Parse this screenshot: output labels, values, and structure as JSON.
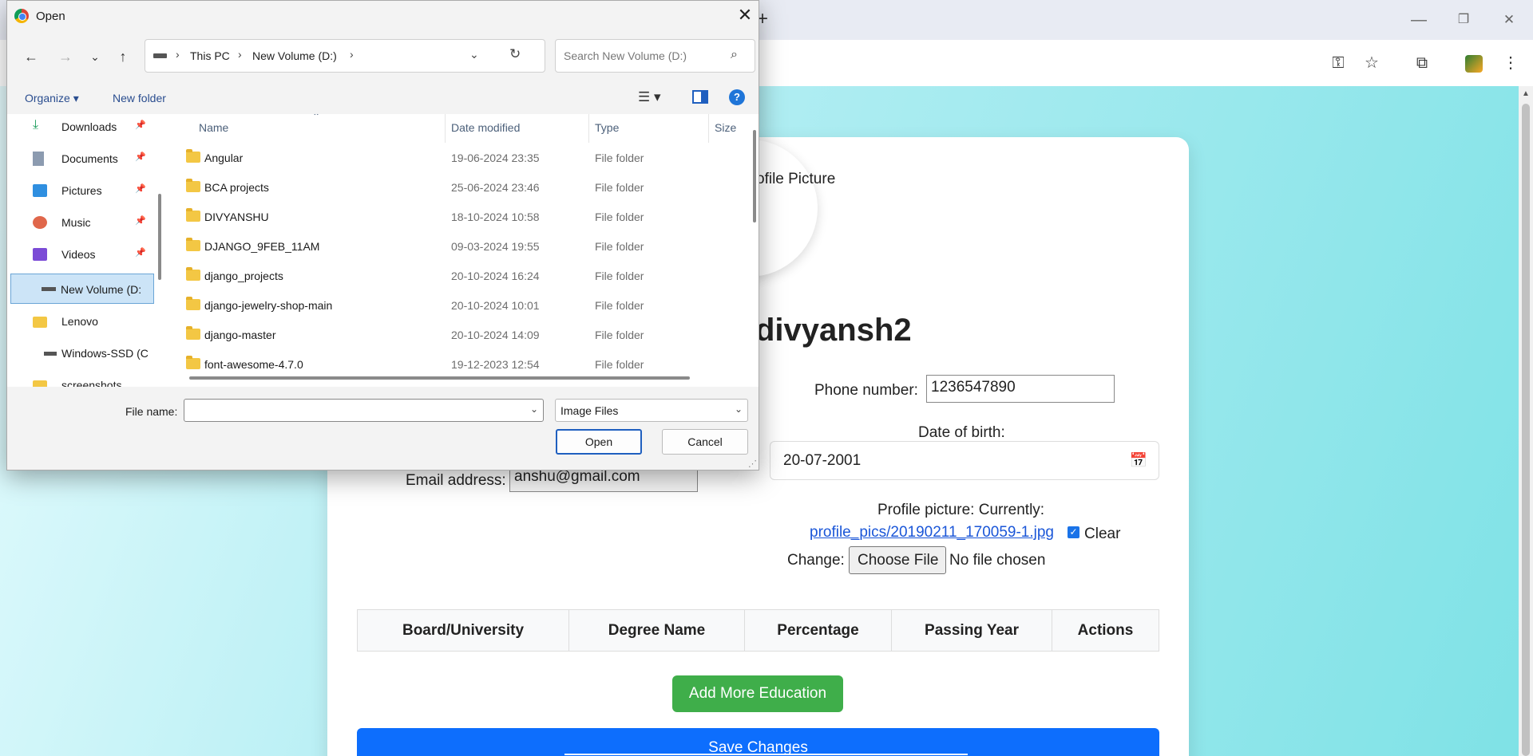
{
  "browser": {
    "new_tab_icon": "+",
    "win_minimize": "—",
    "win_restore": "❐",
    "win_close": "✕"
  },
  "page": {
    "avatar_alt_text": "Profile Picture",
    "username": "divyansh2",
    "phone_label": "Phone number:",
    "phone_value": "1236547890",
    "dob_label": "Date of birth:",
    "dob_value": "20-07-2001",
    "email_label": "Email address:",
    "email_value": "anshu@gmail.com",
    "profile_pic_label": "Profile picture: Currently:",
    "profile_pic_link": "profile_pics/20190211_170059-1.jpg",
    "clear_label": "Clear",
    "change_label": "Change:",
    "choose_file_label": "Choose File",
    "no_file_text": "No file chosen",
    "education_table_headers": [
      "Board/University",
      "Degree Name",
      "Percentage",
      "Passing Year",
      "Actions"
    ],
    "add_education_label": "Add More Education",
    "save_label": "Save Changes"
  },
  "dialog": {
    "title": "Open",
    "breadcrumbs": [
      "This PC",
      "New Volume (D:)"
    ],
    "search_placeholder": "Search New Volume (D:)",
    "organize_label": "Organize ▾",
    "new_folder_label": "New folder",
    "help_label": "?",
    "nav_items": [
      {
        "label": "Downloads",
        "icon": "download-icon",
        "pinned": true
      },
      {
        "label": "Documents",
        "icon": "documents-icon",
        "pinned": true
      },
      {
        "label": "Pictures",
        "icon": "pictures-icon",
        "pinned": true
      },
      {
        "label": "Music",
        "icon": "music-icon",
        "pinned": true
      },
      {
        "label": "Videos",
        "icon": "videos-icon",
        "pinned": true
      },
      {
        "label": "New Volume (D:",
        "icon": "drive-icon",
        "pinned": false,
        "selected": true
      },
      {
        "label": "Lenovo",
        "icon": "folder-icon",
        "pinned": false
      },
      {
        "label": "Windows-SSD (C",
        "icon": "drive-icon",
        "pinned": false
      },
      {
        "label": "screenshots",
        "icon": "folder-icon",
        "pinned": false
      }
    ],
    "columns": [
      "Name",
      "Date modified",
      "Type",
      "Size"
    ],
    "files": [
      {
        "name": "Angular",
        "date": "19-06-2024 23:35",
        "type": "File folder"
      },
      {
        "name": "BCA projects",
        "date": "25-06-2024 23:46",
        "type": "File folder"
      },
      {
        "name": "DIVYANSHU",
        "date": "18-10-2024 10:58",
        "type": "File folder"
      },
      {
        "name": "DJANGO_9FEB_11AM",
        "date": "09-03-2024 19:55",
        "type": "File folder"
      },
      {
        "name": "django_projects",
        "date": "20-10-2024 16:24",
        "type": "File folder"
      },
      {
        "name": "django-jewelry-shop-main",
        "date": "20-10-2024 10:01",
        "type": "File folder"
      },
      {
        "name": "django-master",
        "date": "20-10-2024 14:09",
        "type": "File folder"
      },
      {
        "name": "font-awesome-4.7.0",
        "date": "19-12-2023 12:54",
        "type": "File folder"
      }
    ],
    "file_name_label": "File name:",
    "file_name_value": "",
    "file_type_value": "Image Files",
    "open_label": "Open",
    "cancel_label": "Cancel"
  }
}
